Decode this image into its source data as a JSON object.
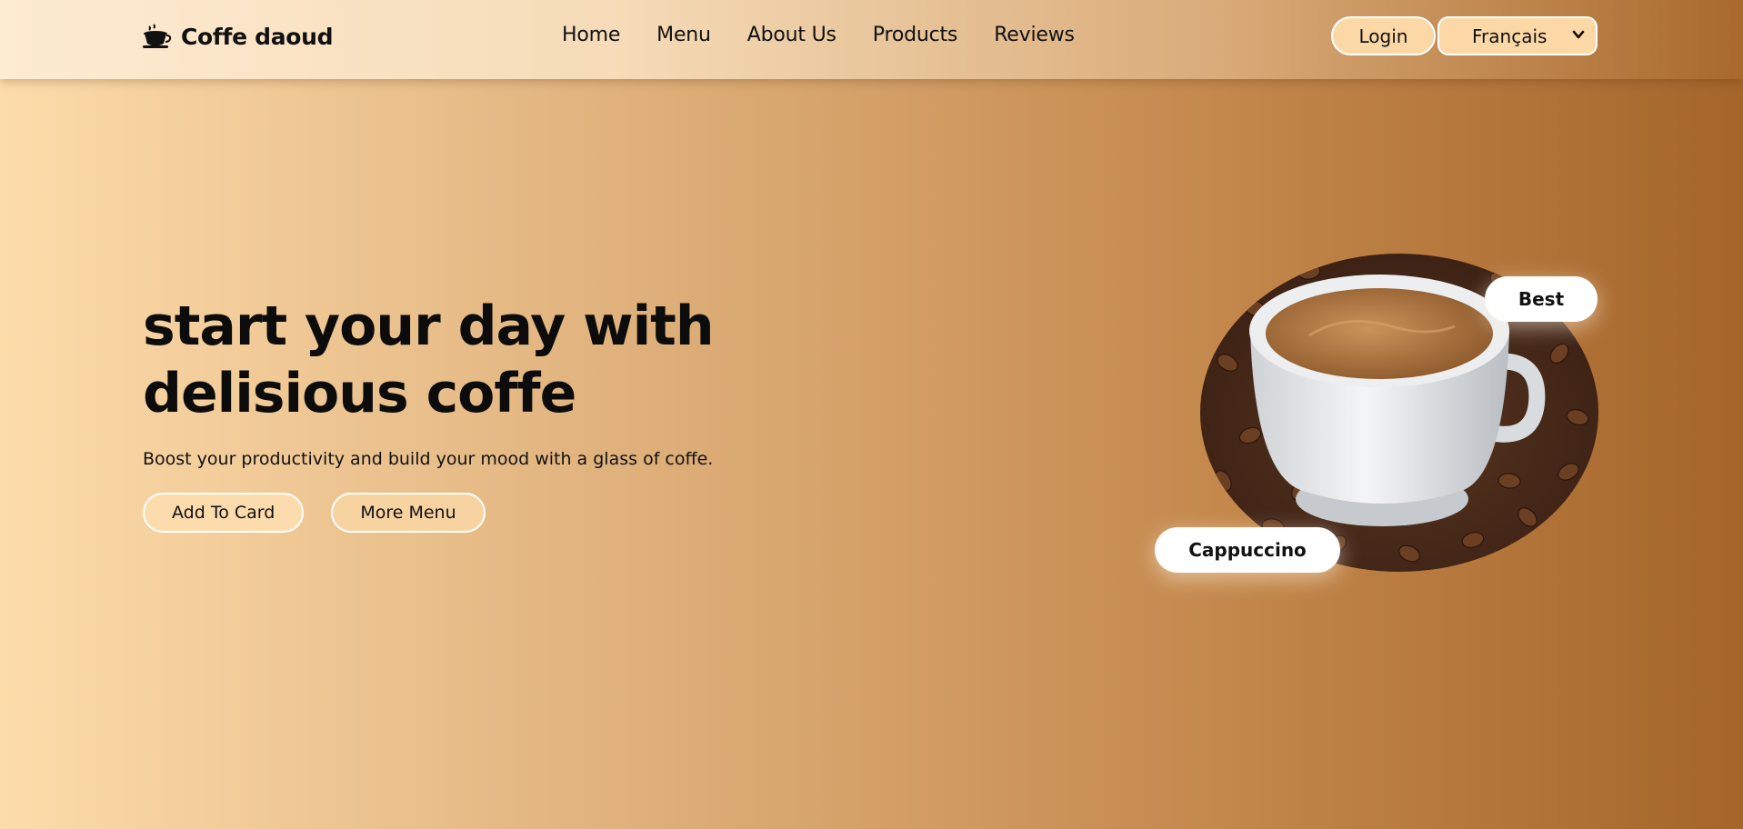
{
  "brand": {
    "name": "Coffe daoud",
    "icon": "coffee-cup-icon"
  },
  "nav": {
    "items": [
      {
        "label": "Home"
      },
      {
        "label": "Menu"
      },
      {
        "label": "About Us"
      },
      {
        "label": "Products"
      },
      {
        "label": "Reviews"
      }
    ]
  },
  "header_actions": {
    "login_label": "Login",
    "language": {
      "selected": "Français",
      "icon": "chevron-down-icon"
    }
  },
  "hero": {
    "title_line1": "start your day with",
    "title_line2": "delisious coffe",
    "subtitle": "Boost your productivity and build your mood with a glass of coffe.",
    "primary_button": "Add To Card",
    "secondary_button": "More Menu"
  },
  "featured": {
    "badge": "Best",
    "product_name": "Cappuccino",
    "image": "coffee-cup-on-beans"
  },
  "colors": {
    "gradient_start": "#fddcab",
    "gradient_end": "#a5652a",
    "button_fill": "#fcdcad",
    "text": "#111111"
  }
}
